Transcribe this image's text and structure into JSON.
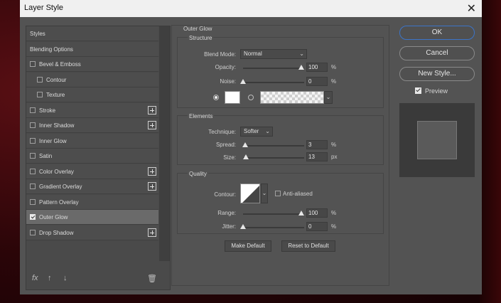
{
  "window": {
    "title": "Layer Style"
  },
  "styles_list": [
    {
      "label": "Styles",
      "checkbox": false,
      "checked": false,
      "indent": 0,
      "plus": false,
      "selected": false
    },
    {
      "label": "Blending Options",
      "checkbox": false,
      "checked": false,
      "indent": 0,
      "plus": false,
      "selected": false
    },
    {
      "label": "Bevel & Emboss",
      "checkbox": true,
      "checked": false,
      "indent": 0,
      "plus": false,
      "selected": false
    },
    {
      "label": "Contour",
      "checkbox": true,
      "checked": false,
      "indent": 1,
      "plus": false,
      "selected": false
    },
    {
      "label": "Texture",
      "checkbox": true,
      "checked": false,
      "indent": 1,
      "plus": false,
      "selected": false
    },
    {
      "label": "Stroke",
      "checkbox": true,
      "checked": false,
      "indent": 0,
      "plus": true,
      "selected": false
    },
    {
      "label": "Inner Shadow",
      "checkbox": true,
      "checked": false,
      "indent": 0,
      "plus": true,
      "selected": false
    },
    {
      "label": "Inner Glow",
      "checkbox": true,
      "checked": false,
      "indent": 0,
      "plus": false,
      "selected": false
    },
    {
      "label": "Satin",
      "checkbox": true,
      "checked": false,
      "indent": 0,
      "plus": false,
      "selected": false
    },
    {
      "label": "Color Overlay",
      "checkbox": true,
      "checked": false,
      "indent": 0,
      "plus": true,
      "selected": false
    },
    {
      "label": "Gradient Overlay",
      "checkbox": true,
      "checked": false,
      "indent": 0,
      "plus": true,
      "selected": false
    },
    {
      "label": "Pattern Overlay",
      "checkbox": true,
      "checked": false,
      "indent": 0,
      "plus": false,
      "selected": false
    },
    {
      "label": "Outer Glow",
      "checkbox": true,
      "checked": true,
      "indent": 0,
      "plus": false,
      "selected": true
    },
    {
      "label": "Drop Shadow",
      "checkbox": true,
      "checked": false,
      "indent": 0,
      "plus": true,
      "selected": false
    }
  ],
  "bottom_icons": {
    "fx": "fx",
    "up": "↑",
    "down": "↓",
    "trash": "🗑"
  },
  "panel": {
    "title": "Outer Glow",
    "structure": {
      "title": "Structure",
      "blend_mode_label": "Blend Mode:",
      "blend_mode_value": "Normal",
      "opacity_label": "Opacity:",
      "opacity_value": "100",
      "opacity_unit": "%",
      "opacity_level": 1.0,
      "noise_label": "Noise:",
      "noise_value": "0",
      "noise_unit": "%",
      "noise_level": 0.0,
      "color_swatch": "#ffffff"
    },
    "elements": {
      "title": "Elements",
      "technique_label": "Technique:",
      "technique_value": "Softer",
      "spread_label": "Spread:",
      "spread_value": "3",
      "spread_unit": "%",
      "spread_level": 0.03,
      "size_label": "Size:",
      "size_value": "13",
      "size_unit": "px",
      "size_level": 0.05
    },
    "quality": {
      "title": "Quality",
      "contour_label": "Contour:",
      "anti_aliased_label": "Anti-aliased",
      "range_label": "Range:",
      "range_value": "100",
      "range_unit": "%",
      "range_level": 1.0,
      "jitter_label": "Jitter:",
      "jitter_value": "0",
      "jitter_unit": "%",
      "jitter_level": 0.0
    },
    "make_default": "Make Default",
    "reset_default": "Reset to Default"
  },
  "buttons": {
    "ok": "OK",
    "cancel": "Cancel",
    "new_style": "New Style..."
  },
  "preview": {
    "label": "Preview",
    "checked": true
  }
}
